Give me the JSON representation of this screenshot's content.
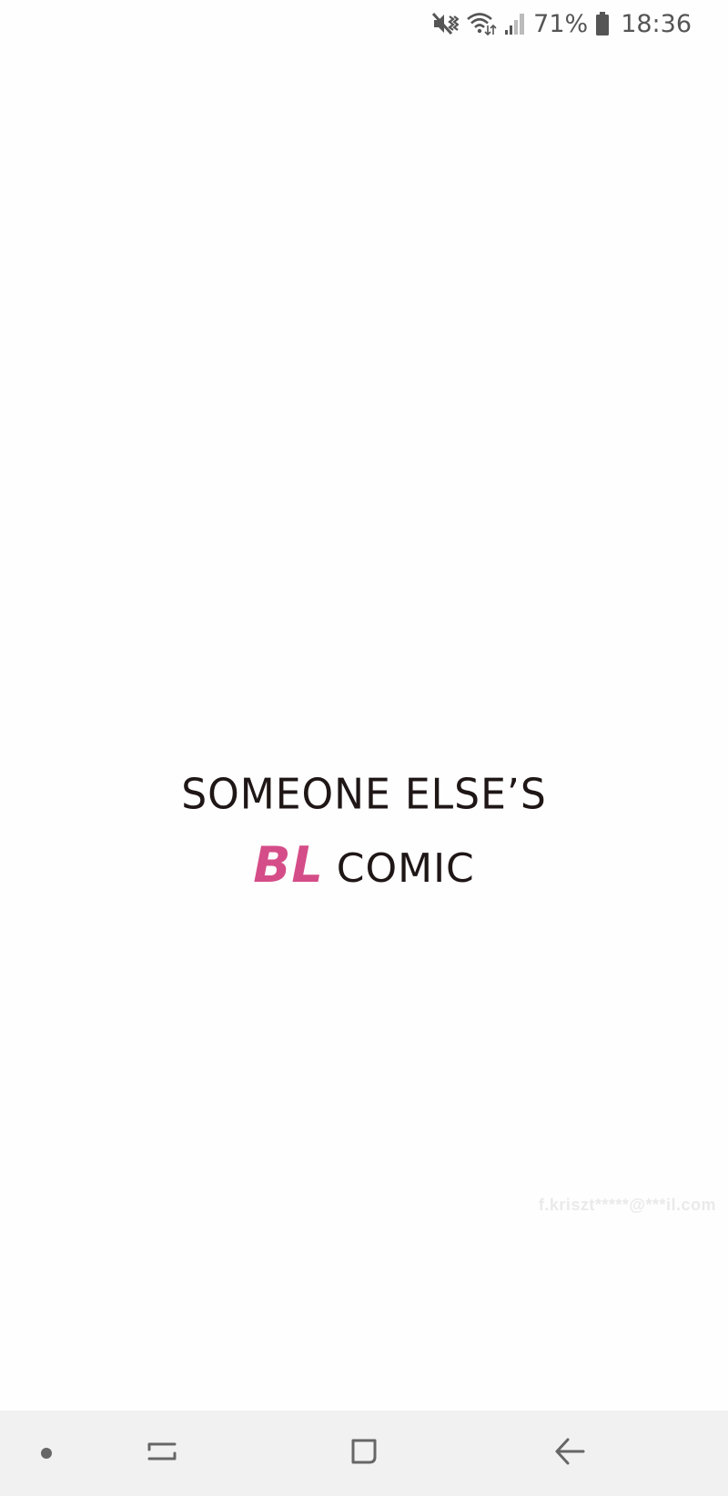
{
  "status_bar": {
    "icons": [
      "mute-vibrate-icon",
      "wifi-icon",
      "signal-icon",
      "battery-icon"
    ],
    "battery_percent": "71%",
    "time": "18:36",
    "icon_color": "#555555"
  },
  "content": {
    "title_line1": "SOMEONE ELSE’S",
    "title_bl": "BL",
    "title_comic": "COMIC",
    "accent_color": "#d54d88",
    "text_color": "#1f1616",
    "watermark": "f.kriszt*****@***il.com"
  },
  "nav_bar": {
    "icons": [
      "dot-icon",
      "recent-apps-icon",
      "home-icon",
      "back-icon"
    ],
    "background": "#f1f1f1"
  }
}
